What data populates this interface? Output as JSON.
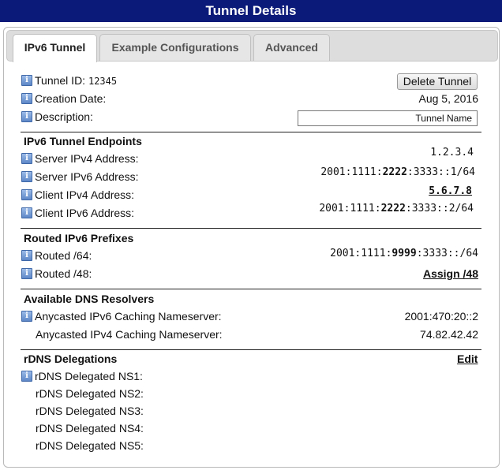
{
  "title": "Tunnel Details",
  "tabs": [
    "IPv6 Tunnel",
    "Example Configurations",
    "Advanced"
  ],
  "tunnel": {
    "id_label": "Tunnel ID:",
    "id_value": "12345",
    "delete_button": "Delete Tunnel",
    "creation_label": "Creation Date:",
    "creation_value": "Aug 5, 2016",
    "description_label": "Description:",
    "description_value": "Tunnel Name"
  },
  "endpoints": {
    "title": "IPv6 Tunnel Endpoints",
    "server_ipv4_label": "Server IPv4 Address:",
    "server_ipv4_value": "1.2.3.4",
    "server_ipv6_label": "Server IPv6 Address:",
    "server_ipv6_pre": "2001:1111:",
    "server_ipv6_bold": "2222",
    "server_ipv6_post": ":3333::1/64",
    "client_ipv4_label": "Client IPv4 Address:",
    "client_ipv4_value": "5.6.7.8",
    "client_ipv6_label": "Client IPv6 Address:",
    "client_ipv6_pre": "2001:1111:",
    "client_ipv6_bold": "2222",
    "client_ipv6_post": ":3333::2/64"
  },
  "prefixes": {
    "title": "Routed IPv6 Prefixes",
    "routed64_label": "Routed /64:",
    "routed64_pre": "2001:1111:",
    "routed64_bold": "9999",
    "routed64_post": ":3333::/64",
    "routed48_label": "Routed /48:",
    "routed48_link": "Assign /48"
  },
  "dns": {
    "title": "Available DNS Resolvers",
    "ipv6_label": "Anycasted IPv6 Caching Nameserver:",
    "ipv6_value": "2001:470:20::2",
    "ipv4_label": "Anycasted IPv4 Caching Nameserver:",
    "ipv4_value": "74.82.42.42"
  },
  "rdns": {
    "title": "rDNS Delegations",
    "edit_link": "Edit",
    "ns": [
      "rDNS Delegated NS1:",
      "rDNS Delegated NS2:",
      "rDNS Delegated NS3:",
      "rDNS Delegated NS4:",
      "rDNS Delegated NS5:"
    ]
  },
  "colors": {
    "titlebar": "#0b1a78",
    "info_icon": "#5d87c7"
  },
  "icons": {
    "info": "info-icon"
  }
}
